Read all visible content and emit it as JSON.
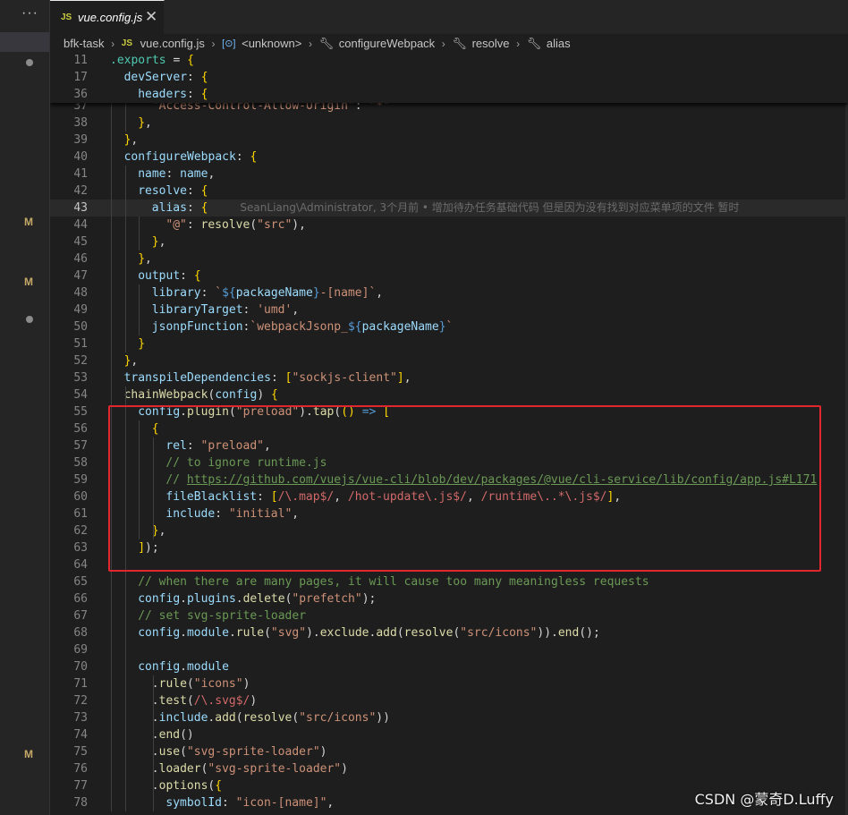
{
  "sidebar": {
    "more_label": "···",
    "git_marks": [
      "M",
      "M",
      "M"
    ]
  },
  "tab": {
    "icon_label": "JS",
    "filename": "vue.config.js",
    "close_label": "✕"
  },
  "breadcrumb": [
    {
      "text": "bfk-task",
      "icon": ""
    },
    {
      "text": "vue.config.js",
      "icon": "js-file-icon",
      "icon_label": "JS"
    },
    {
      "text": "<unknown>",
      "icon": "symbol-box-icon",
      "icon_label": "[⊙]"
    },
    {
      "text": "configureWebpack",
      "icon": "wrench-icon",
      "icon_label": "🔧︎"
    },
    {
      "text": "resolve",
      "icon": "wrench-icon",
      "icon_label": "🔧︎"
    },
    {
      "text": "alias",
      "icon": "wrench-icon",
      "icon_label": "🔧︎"
    }
  ],
  "sticky": [
    {
      "n": "11",
      "indent": 0,
      "t": [
        [
          "module",
          ".exports"
        ],
        [
          "w",
          " = "
        ],
        [
          "p",
          "{"
        ]
      ]
    },
    {
      "n": "17",
      "indent": 1,
      "t": [
        [
          "v",
          "devServer"
        ],
        [
          "w",
          ": "
        ],
        [
          "p",
          "{"
        ]
      ]
    },
    {
      "n": "36",
      "indent": 2,
      "t": [
        [
          "v",
          "headers"
        ],
        [
          "w",
          ": "
        ],
        [
          "p",
          "{"
        ]
      ]
    }
  ],
  "lines": [
    {
      "n": "37",
      "indent": 3,
      "t": [
        [
          "s",
          "\"Access-Control-Allow-Origin\""
        ],
        [
          "w",
          ": "
        ],
        [
          "s",
          "\"*\""
        ]
      ]
    },
    {
      "n": "38",
      "indent": 2,
      "t": [
        [
          "p",
          "}"
        ],
        [
          "w",
          ","
        ]
      ]
    },
    {
      "n": "39",
      "indent": 1,
      "t": [
        [
          "p",
          "}"
        ],
        [
          "w",
          ","
        ]
      ]
    },
    {
      "n": "40",
      "indent": 1,
      "t": [
        [
          "v",
          "configureWebpack"
        ],
        [
          "w",
          ": "
        ],
        [
          "p",
          "{"
        ]
      ]
    },
    {
      "n": "41",
      "indent": 2,
      "t": [
        [
          "v",
          "name"
        ],
        [
          "w",
          ": "
        ],
        [
          "v",
          "name"
        ],
        [
          "w",
          ","
        ]
      ]
    },
    {
      "n": "42",
      "indent": 2,
      "t": [
        [
          "v",
          "resolve"
        ],
        [
          "w",
          ": "
        ],
        [
          "p",
          "{"
        ]
      ]
    },
    {
      "n": "43",
      "indent": 3,
      "cur": true,
      "t": [
        [
          "v",
          "alias"
        ],
        [
          "w",
          ": "
        ],
        [
          "p",
          "{"
        ]
      ],
      "blame": "SeanLiang\\Administrator, 3个月前 • 增加待办任务基础代码 但是因为没有找到对应菜单项的文件 暂时"
    },
    {
      "n": "44",
      "indent": 4,
      "t": [
        [
          "s",
          "\"@\""
        ],
        [
          "w",
          ": "
        ],
        [
          "f",
          "resolve"
        ],
        [
          "w",
          "("
        ],
        [
          "s",
          "\"src\""
        ],
        [
          "w",
          "),"
        ]
      ]
    },
    {
      "n": "45",
      "indent": 3,
      "t": [
        [
          "p",
          "}"
        ],
        [
          "w",
          ","
        ]
      ]
    },
    {
      "n": "46",
      "indent": 2,
      "t": [
        [
          "p",
          "}"
        ],
        [
          "w",
          ","
        ]
      ]
    },
    {
      "n": "47",
      "indent": 2,
      "t": [
        [
          "v",
          "output"
        ],
        [
          "w",
          ": "
        ],
        [
          "p",
          "{"
        ]
      ]
    },
    {
      "n": "48",
      "indent": 3,
      "t": [
        [
          "v",
          "library"
        ],
        [
          "w",
          ": "
        ],
        [
          "s",
          "`"
        ],
        [
          "k",
          "${"
        ],
        [
          "v",
          "packageName"
        ],
        [
          "k",
          "}"
        ],
        [
          "s",
          "-[name]`"
        ],
        [
          "w",
          ","
        ]
      ]
    },
    {
      "n": "49",
      "indent": 3,
      "t": [
        [
          "v",
          "libraryTarget"
        ],
        [
          "w",
          ": "
        ],
        [
          "s",
          "'umd'"
        ],
        [
          "w",
          ","
        ]
      ]
    },
    {
      "n": "50",
      "indent": 3,
      "t": [
        [
          "v",
          "jsonpFunction"
        ],
        [
          "w",
          ":"
        ],
        [
          "s",
          "`webpackJsonp_"
        ],
        [
          "k",
          "${"
        ],
        [
          "v",
          "packageName"
        ],
        [
          "k",
          "}"
        ],
        [
          "s",
          "`"
        ]
      ]
    },
    {
      "n": "51",
      "indent": 2,
      "t": [
        [
          "p",
          "}"
        ]
      ]
    },
    {
      "n": "52",
      "indent": 1,
      "t": [
        [
          "p",
          "}"
        ],
        [
          "w",
          ","
        ]
      ]
    },
    {
      "n": "53",
      "indent": 1,
      "t": [
        [
          "v",
          "transpileDependencies"
        ],
        [
          "w",
          ": "
        ],
        [
          "p",
          "["
        ],
        [
          "s",
          "\"sockjs-client\""
        ],
        [
          "p",
          "]"
        ],
        [
          "w",
          ","
        ]
      ]
    },
    {
      "n": "54",
      "indent": 1,
      "t": [
        [
          "f",
          "chainWebpack"
        ],
        [
          "w",
          "("
        ],
        [
          "v",
          "config"
        ],
        [
          "w",
          ") "
        ],
        [
          "p",
          "{"
        ]
      ]
    },
    {
      "n": "55",
      "indent": 2,
      "t": [
        [
          "v",
          "config"
        ],
        [
          "w",
          "."
        ],
        [
          "f",
          "plugin"
        ],
        [
          "w",
          "("
        ],
        [
          "s",
          "\"preload\""
        ],
        [
          "w",
          ")."
        ],
        [
          "f",
          "tap"
        ],
        [
          "w",
          "("
        ],
        [
          "p",
          "()"
        ],
        [
          "w",
          " "
        ],
        [
          "k",
          "=>"
        ],
        [
          "w",
          " "
        ],
        [
          "p",
          "["
        ]
      ]
    },
    {
      "n": "56",
      "indent": 3,
      "t": [
        [
          "p",
          "{"
        ]
      ]
    },
    {
      "n": "57",
      "indent": 4,
      "t": [
        [
          "v",
          "rel"
        ],
        [
          "w",
          ": "
        ],
        [
          "s",
          "\"preload\""
        ],
        [
          "w",
          ","
        ]
      ]
    },
    {
      "n": "58",
      "indent": 4,
      "t": [
        [
          "c",
          "// to ignore runtime.js"
        ]
      ]
    },
    {
      "n": "59",
      "indent": 4,
      "t": [
        [
          "c",
          "// "
        ],
        [
          "u",
          "https://github.com/vuejs/vue-cli/blob/dev/packages/@vue/cli-service/lib/config/app.js#L171"
        ]
      ]
    },
    {
      "n": "60",
      "indent": 4,
      "t": [
        [
          "v",
          "fileBlacklist"
        ],
        [
          "w",
          ": "
        ],
        [
          "p",
          "["
        ],
        [
          "r",
          "/\\.map$/"
        ],
        [
          "w",
          ", "
        ],
        [
          "r",
          "/hot-update\\.js$/"
        ],
        [
          "w",
          ", "
        ],
        [
          "r",
          "/runtime\\..*\\.js$/"
        ],
        [
          "p",
          "]"
        ],
        [
          "w",
          ","
        ]
      ]
    },
    {
      "n": "61",
      "indent": 4,
      "t": [
        [
          "v",
          "include"
        ],
        [
          "w",
          ": "
        ],
        [
          "s",
          "\"initial\""
        ],
        [
          "w",
          ","
        ]
      ]
    },
    {
      "n": "62",
      "indent": 3,
      "t": [
        [
          "p",
          "}"
        ],
        [
          "w",
          ","
        ]
      ]
    },
    {
      "n": "63",
      "indent": 2,
      "t": [
        [
          "p",
          "]"
        ],
        [
          "w",
          ");"
        ]
      ]
    },
    {
      "n": "64",
      "indent": 0,
      "t": []
    },
    {
      "n": "65",
      "indent": 2,
      "t": [
        [
          "c",
          "// when there are many pages, it will cause too many meaningless requests"
        ]
      ]
    },
    {
      "n": "66",
      "indent": 2,
      "t": [
        [
          "v",
          "config"
        ],
        [
          "w",
          "."
        ],
        [
          "v",
          "plugins"
        ],
        [
          "w",
          "."
        ],
        [
          "f",
          "delete"
        ],
        [
          "w",
          "("
        ],
        [
          "s",
          "\"prefetch\""
        ],
        [
          "w",
          ");"
        ]
      ]
    },
    {
      "n": "67",
      "indent": 2,
      "t": [
        [
          "c",
          "// set svg-sprite-loader"
        ]
      ]
    },
    {
      "n": "68",
      "indent": 2,
      "t": [
        [
          "v",
          "config"
        ],
        [
          "w",
          "."
        ],
        [
          "v",
          "module"
        ],
        [
          "w",
          "."
        ],
        [
          "f",
          "rule"
        ],
        [
          "w",
          "("
        ],
        [
          "s",
          "\"svg\""
        ],
        [
          "w",
          ")."
        ],
        [
          "f",
          "exclude"
        ],
        [
          "w",
          "."
        ],
        [
          "f",
          "add"
        ],
        [
          "w",
          "("
        ],
        [
          "f",
          "resolve"
        ],
        [
          "w",
          "("
        ],
        [
          "s",
          "\"src/icons\""
        ],
        [
          "w",
          "))."
        ],
        [
          "f",
          "end"
        ],
        [
          "w",
          "();"
        ]
      ]
    },
    {
      "n": "69",
      "indent": 0,
      "t": []
    },
    {
      "n": "70",
      "indent": 2,
      "t": [
        [
          "v",
          "config"
        ],
        [
          "w",
          "."
        ],
        [
          "v",
          "module"
        ]
      ]
    },
    {
      "n": "71",
      "indent": 3,
      "t": [
        [
          "w",
          "."
        ],
        [
          "f",
          "rule"
        ],
        [
          "w",
          "("
        ],
        [
          "s",
          "\"icons\""
        ],
        [
          "w",
          ")"
        ]
      ]
    },
    {
      "n": "72",
      "indent": 3,
      "t": [
        [
          "w",
          "."
        ],
        [
          "f",
          "test"
        ],
        [
          "w",
          "("
        ],
        [
          "r",
          "/\\.svg$/"
        ],
        [
          "w",
          ")"
        ]
      ]
    },
    {
      "n": "73",
      "indent": 3,
      "t": [
        [
          "w",
          "."
        ],
        [
          "v",
          "include"
        ],
        [
          "w",
          "."
        ],
        [
          "f",
          "add"
        ],
        [
          "w",
          "("
        ],
        [
          "f",
          "resolve"
        ],
        [
          "w",
          "("
        ],
        [
          "s",
          "\"src/icons\""
        ],
        [
          "w",
          "))"
        ]
      ]
    },
    {
      "n": "74",
      "indent": 3,
      "t": [
        [
          "w",
          "."
        ],
        [
          "f",
          "end"
        ],
        [
          "w",
          "()"
        ]
      ]
    },
    {
      "n": "75",
      "indent": 3,
      "t": [
        [
          "w",
          "."
        ],
        [
          "f",
          "use"
        ],
        [
          "w",
          "("
        ],
        [
          "s",
          "\"svg-sprite-loader\""
        ],
        [
          "w",
          ")"
        ]
      ]
    },
    {
      "n": "76",
      "indent": 3,
      "t": [
        [
          "w",
          "."
        ],
        [
          "f",
          "loader"
        ],
        [
          "w",
          "("
        ],
        [
          "s",
          "\"svg-sprite-loader\""
        ],
        [
          "w",
          ")"
        ]
      ]
    },
    {
      "n": "77",
      "indent": 3,
      "t": [
        [
          "w",
          "."
        ],
        [
          "f",
          "options"
        ],
        [
          "w",
          "("
        ],
        [
          "p",
          "{"
        ]
      ]
    },
    {
      "n": "78",
      "indent": 4,
      "t": [
        [
          "v",
          "symbolId"
        ],
        [
          "w",
          ": "
        ],
        [
          "s",
          "\"icon-[name]\""
        ],
        [
          "w",
          ","
        ]
      ]
    }
  ],
  "colors": {
    "v": "#9cdcfe",
    "s": "#ce9178",
    "f": "#dcdcaa",
    "k": "#569cd6",
    "c": "#6a9955",
    "r": "#d16969",
    "p": "#ffd700",
    "w": "#d4d4d4",
    "module": "#4ec9b0",
    "u": "#6a9955"
  },
  "watermark": "CSDN @蒙奇D.Luffy"
}
